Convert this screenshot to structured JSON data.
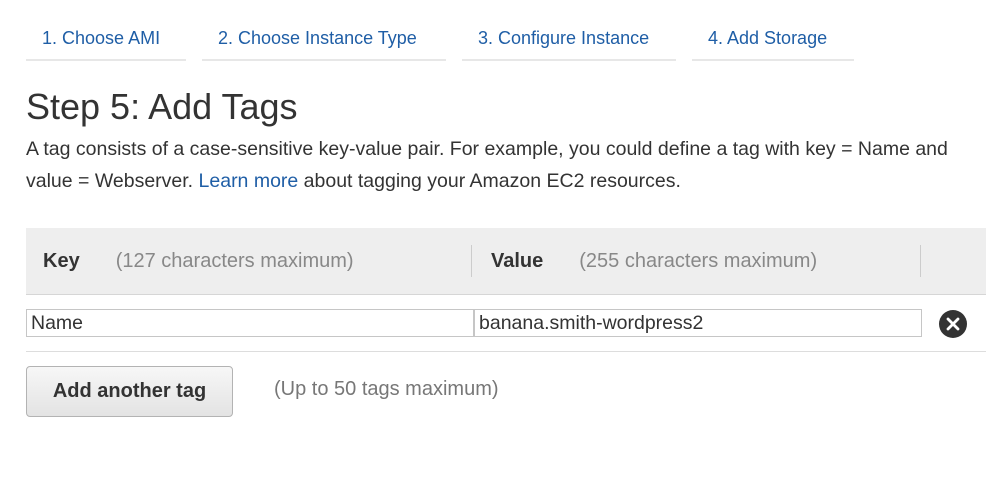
{
  "wizard": {
    "tabs": [
      {
        "label": "1. Choose AMI"
      },
      {
        "label": "2. Choose Instance Type"
      },
      {
        "label": "3. Configure Instance"
      },
      {
        "label": "4. Add Storage"
      }
    ]
  },
  "page": {
    "title": "Step 5: Add Tags",
    "description_before": "A tag consists of a case-sensitive key-value pair. For example, you could define a tag with key = Name and value = Webserver.",
    "learn_more": "Learn more",
    "description_after": "about tagging your Amazon EC2 resources."
  },
  "table": {
    "key_header": "Key",
    "key_hint": "(127 characters maximum)",
    "value_header": "Value",
    "value_hint": "(255 characters maximum)",
    "rows": [
      {
        "key": "Name",
        "value": "banana.smith-wordpress2",
        "remove_icon": "close-circle-icon"
      }
    ]
  },
  "actions": {
    "add_tag_label": "Add another tag",
    "limit_note": "(Up to 50 tags maximum)"
  },
  "colors": {
    "link": "#1f5ea6",
    "header_bg": "#eeeeee",
    "remove_icon_bg": "#333333"
  }
}
